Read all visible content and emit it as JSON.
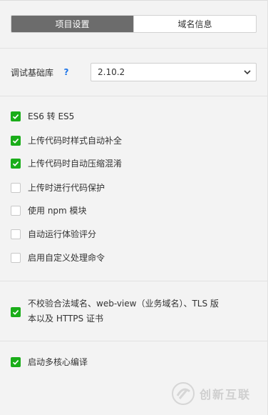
{
  "tabs": [
    {
      "label": "项目设置",
      "active": true
    },
    {
      "label": "域名信息",
      "active": false
    }
  ],
  "debug_library": {
    "label": "调试基础库",
    "help": "?",
    "selected_version": "2.10.2"
  },
  "options": [
    {
      "label": "ES6 转 ES5",
      "checked": true
    },
    {
      "label": "上传代码时样式自动补全",
      "checked": true
    },
    {
      "label": "上传代码时自动压缩混淆",
      "checked": true
    },
    {
      "label": "上传时进行代码保护",
      "checked": false
    },
    {
      "label": "使用 npm 模块",
      "checked": false
    },
    {
      "label": "自动运行体验评分",
      "checked": false
    },
    {
      "label": "启用自定义处理命令",
      "checked": false
    }
  ],
  "domain_check": {
    "line1": "不校验合法域名、web-view（业务域名）、TLS 版",
    "line2": "本以及 HTTPS 证书",
    "checked": true
  },
  "multicore": {
    "label": "启动多核心编译",
    "checked": true
  },
  "watermark": {
    "text": "创新互联"
  },
  "colors": {
    "accent": "#1aad19",
    "tab_active": "#6c6c6c",
    "help": "#1a73e8"
  }
}
